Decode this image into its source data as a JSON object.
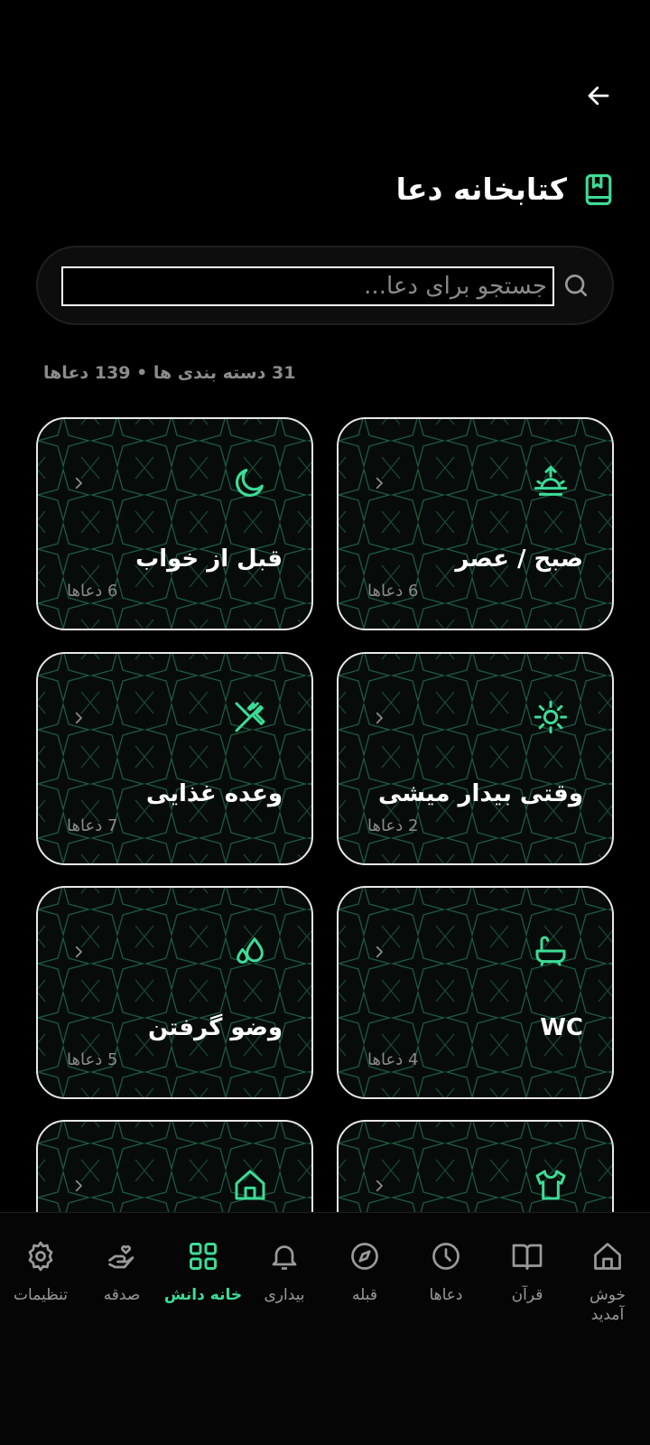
{
  "header": {
    "title": "کتابخانه دعا",
    "back_icon": "arrow-left-icon",
    "title_icon": "bookmark-book-icon"
  },
  "search": {
    "placeholder": "جستجو برای دعا...",
    "value": ""
  },
  "summary": "31 دسته بندی ها • 139 دعاها",
  "colors": {
    "accent": "#3ddc97",
    "background": "#000000",
    "card_border": "#e8e8e8",
    "muted": "#8a8a8a"
  },
  "categories": [
    {
      "name": "صبح / عصر",
      "count": "6 دعاها",
      "icon": "sunrise-icon"
    },
    {
      "name": "قبل از خواب",
      "count": "6 دعاها",
      "icon": "moon-icon"
    },
    {
      "name": "وقتی بیدار میشی",
      "count": "2 دعاها",
      "icon": "sun-icon"
    },
    {
      "name": "وعده غذایی",
      "count": "7 دعاها",
      "icon": "fork-knife-icon"
    },
    {
      "name": "WC",
      "count": "4 دعاها",
      "icon": "bathtub-icon"
    },
    {
      "name": "وضو گرفتن",
      "count": "5 دعاها",
      "icon": "water-drops-icon"
    },
    {
      "name": "",
      "count": "",
      "icon": "shirt-icon"
    },
    {
      "name": "",
      "count": "",
      "icon": "home-icon"
    }
  ],
  "nav": [
    {
      "label": "خوش آمدید",
      "icon": "home-icon",
      "active": false
    },
    {
      "label": "قرآن",
      "icon": "open-book-icon",
      "active": false
    },
    {
      "label": "دعاها",
      "icon": "clock-icon",
      "active": false
    },
    {
      "label": "قبله",
      "icon": "compass-icon",
      "active": false
    },
    {
      "label": "بیداری",
      "icon": "bell-icon",
      "active": false
    },
    {
      "label": "خانه دانش",
      "icon": "grid-icon",
      "active": true
    },
    {
      "label": "صدقه",
      "icon": "hand-heart-icon",
      "active": false
    },
    {
      "label": "تنظیمات",
      "icon": "gear-icon",
      "active": false
    }
  ]
}
